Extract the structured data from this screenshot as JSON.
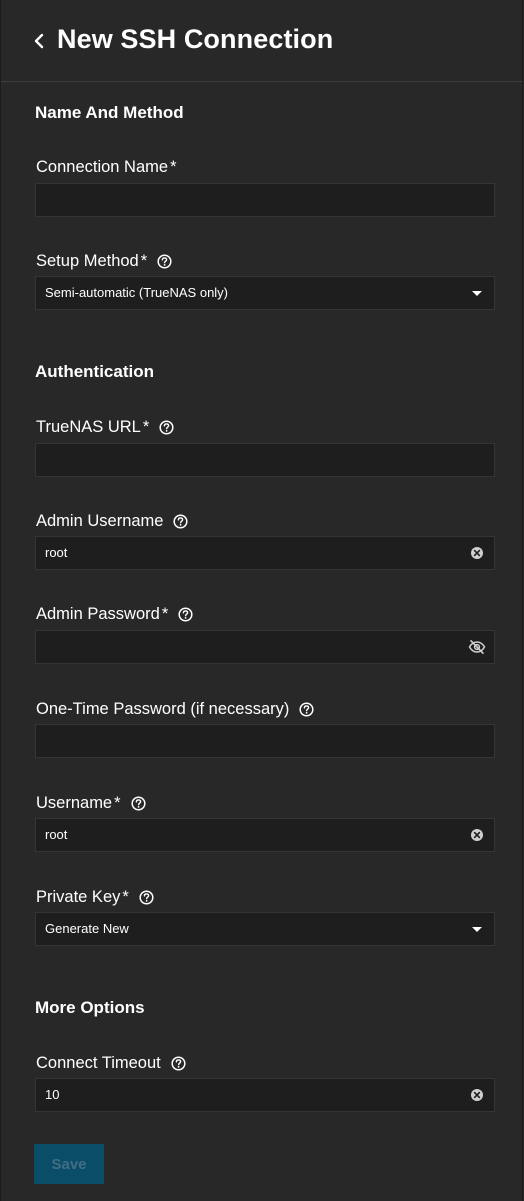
{
  "header": {
    "title": "New SSH Connection",
    "back_icon": "chevron-left-icon"
  },
  "sections": {
    "name_method": "Name And Method",
    "authentication": "Authentication",
    "more_options": "More Options"
  },
  "required_mark": "*",
  "fields": {
    "connection_name": {
      "label": "Connection Name",
      "value": ""
    },
    "setup_method": {
      "label": "Setup Method",
      "value": "Semi-automatic (TrueNAS only)"
    },
    "truenas_url": {
      "label": "TrueNAS URL",
      "value": ""
    },
    "admin_username": {
      "label": "Admin Username",
      "value": "root"
    },
    "admin_password": {
      "label": "Admin Password",
      "value": ""
    },
    "otp": {
      "label": "One-Time Password (if necessary)",
      "value": ""
    },
    "username": {
      "label": "Username",
      "value": "root"
    },
    "private_key": {
      "label": "Private Key",
      "value": "Generate New"
    },
    "connect_timeout": {
      "label": "Connect Timeout",
      "value": "10"
    }
  },
  "actions": {
    "save_label": "Save"
  },
  "colors": {
    "background": "#282828",
    "field_background": "#1e1e1e",
    "save_button": "#0a4d69",
    "save_text_disabled": "#416e83"
  }
}
